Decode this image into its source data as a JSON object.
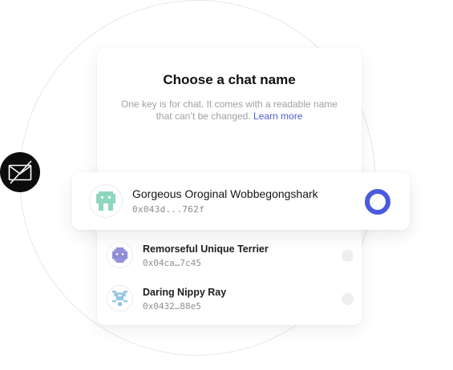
{
  "header": {
    "title": "Choose a chat name",
    "description": "One key is for chat. It comes with a readable name that can’t be changed.",
    "learn_more": "Learn more"
  },
  "badge": {
    "icon": "mail-off-icon"
  },
  "selected": {
    "name": "Gorgeous Oroginal Wobbegongshark",
    "address": "0x043d...762f",
    "avatar_color": "#8ed6bf",
    "radio_color": "#4a5be0"
  },
  "options": [
    {
      "name": "Remorseful Unique Terrier",
      "address": "0x04ca…7c45",
      "avatar_color": "#8e8bd6"
    },
    {
      "name": "Daring Nippy Ray",
      "address": "0x0432…88e5",
      "avatar_color": "#8ec4e0"
    }
  ]
}
